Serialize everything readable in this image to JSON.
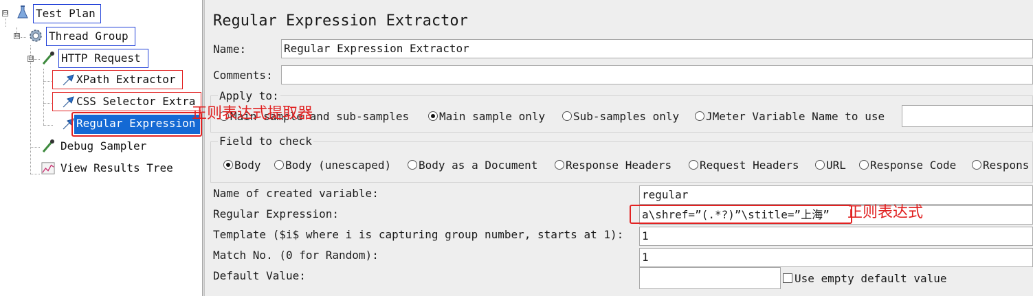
{
  "tree": {
    "test_plan": "Test Plan",
    "thread_group": "Thread Group",
    "http_request": "HTTP Request",
    "xpath_extractor": "XPath Extractor",
    "css_selector_extractor": "CSS Selector Extra",
    "regex_extractor": "Regular Expression",
    "debug_sampler": "Debug Sampler",
    "view_results_tree": "View Results Tree",
    "toggle_symbol": "⊟"
  },
  "panel": {
    "title": "Regular Expression Extractor",
    "name_label": "Name:",
    "name_value": "Regular Expression Extractor",
    "comments_label": "Comments:",
    "comments_value": "",
    "apply_to": {
      "legend": "Apply to:",
      "options": [
        "Main sample and sub-samples",
        "Main sample only",
        "Sub-samples only",
        "JMeter Variable Name to use"
      ],
      "selected": "Main sample only",
      "variable_value": ""
    },
    "field_to_check": {
      "legend": "Field to check",
      "options": [
        "Body",
        "Body (unescaped)",
        "Body as a Document",
        "Response Headers",
        "Request Headers",
        "URL",
        "Response Code",
        "Respons"
      ],
      "selected": "Body"
    },
    "created_variable_label": "Name of created variable:",
    "created_variable_value": "regular",
    "regex_label": "Regular Expression:",
    "regex_value": "a\\shref=”(.*?)”\\stitle=”上海”",
    "template_label": "Template ($i$ where i is capturing group number, starts at 1):",
    "template_value": "1",
    "match_no_label": "Match No. (0 for Random):",
    "match_no_value": "1",
    "default_value_label": "Default Value:",
    "default_value": "",
    "use_empty_default_label": "Use empty default value"
  },
  "annotations": {
    "extractor_note": "正则表达式提取器",
    "regex_note": "正则表达式",
    "color": "#e02020"
  },
  "colors": {
    "selection": "#1469d4",
    "highlight_blue": "#1f3fd8",
    "highlight_red": "#e22222"
  }
}
